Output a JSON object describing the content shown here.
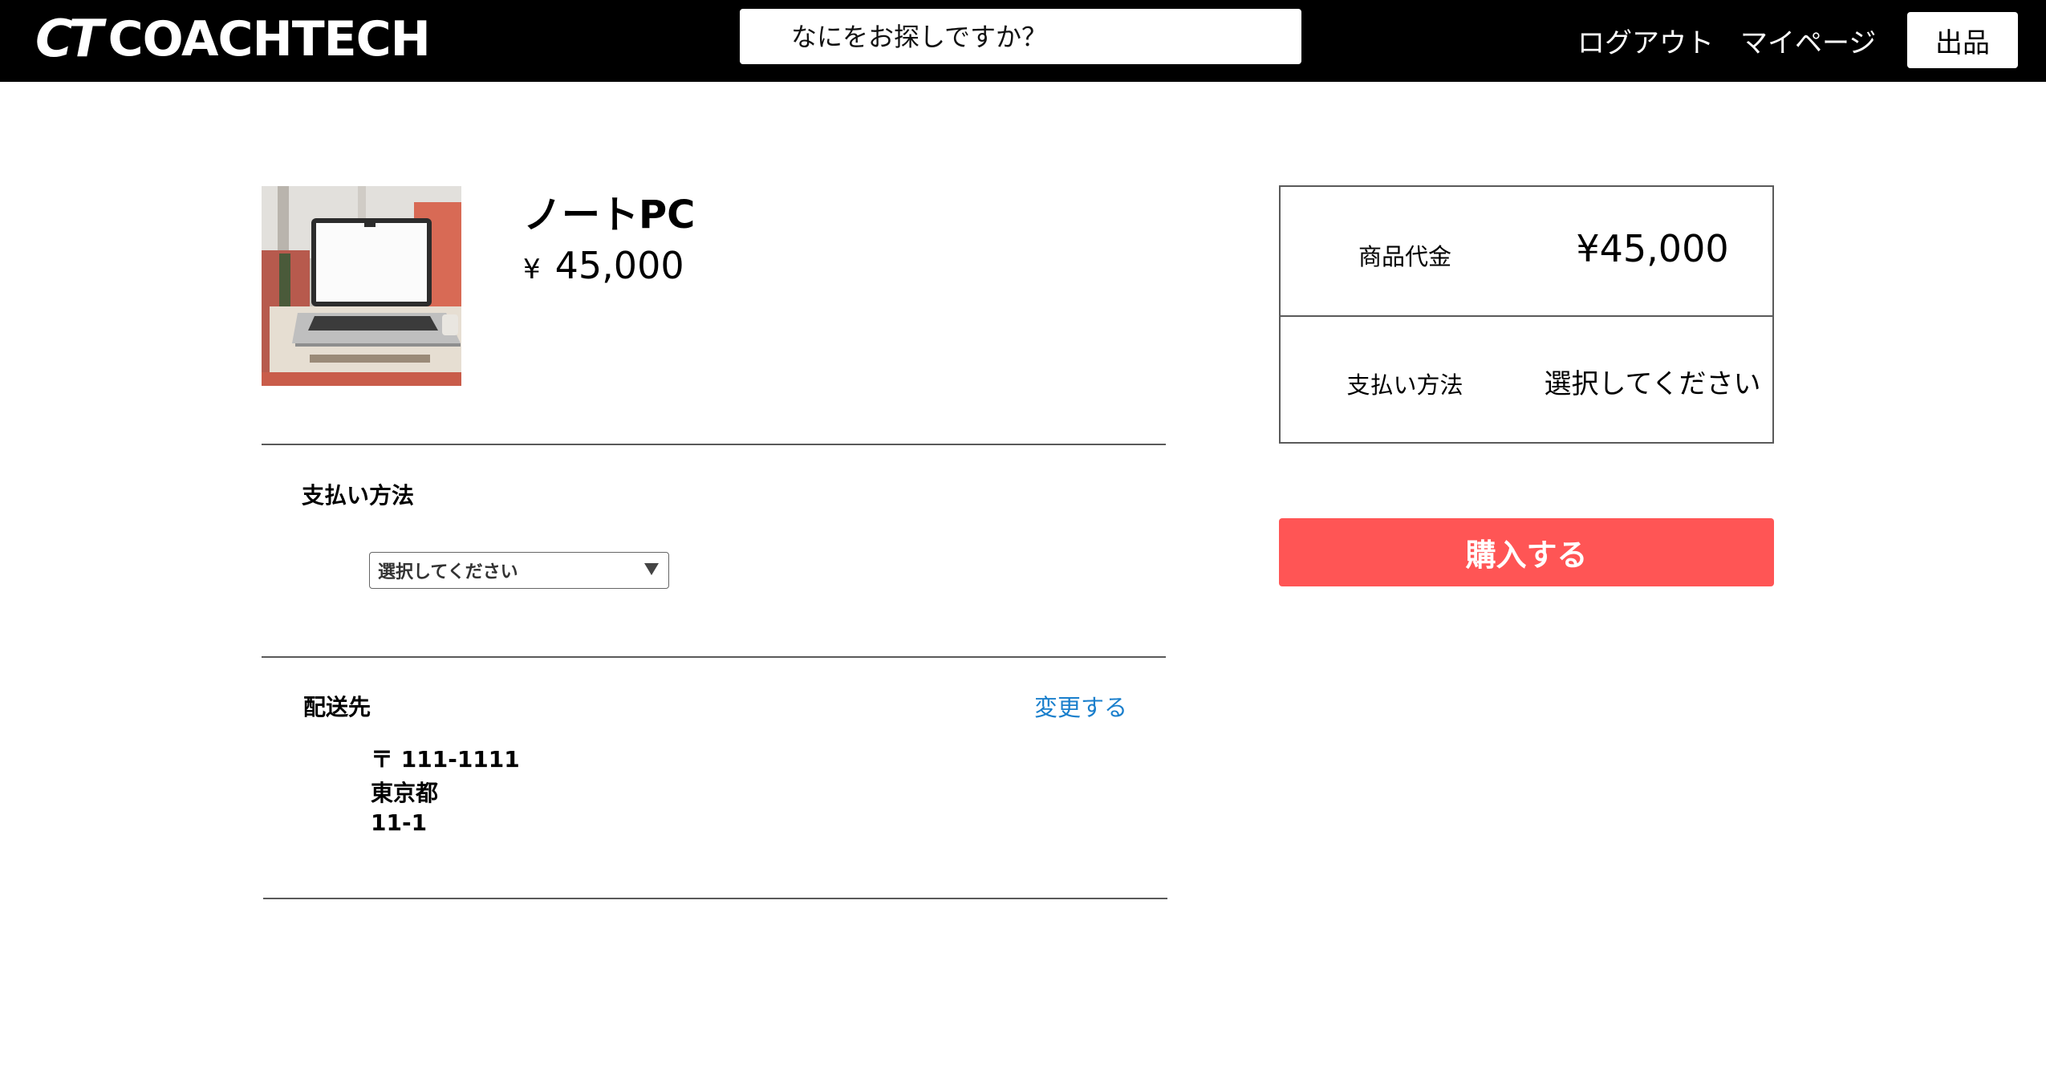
{
  "header": {
    "logo_mark": "CT",
    "logo_text": "COACHTECH",
    "search_placeholder": "なにをお探しですか？",
    "logout_label": "ログアウト",
    "mypage_label": "マイページ",
    "sell_label": "出品"
  },
  "product": {
    "image_icon": "laptop-photo",
    "name": "ノートPC",
    "price_symbol": "¥",
    "price": "45,000"
  },
  "payment": {
    "title": "支払い方法",
    "selected": "選択してください"
  },
  "shipping": {
    "title": "配送先",
    "change_label": "変更する",
    "postal": "〒 111-1111",
    "prefecture": "東京都",
    "address": "11-1"
  },
  "summary": {
    "price_label": "商品代金",
    "price_value": "¥45,000",
    "payment_label": "支払い方法",
    "payment_value": "選択してください"
  },
  "buy_label": "購入する",
  "colors": {
    "header_bg": "#000000",
    "buy_button": "#ff5555",
    "link": "#1a7fcc"
  }
}
